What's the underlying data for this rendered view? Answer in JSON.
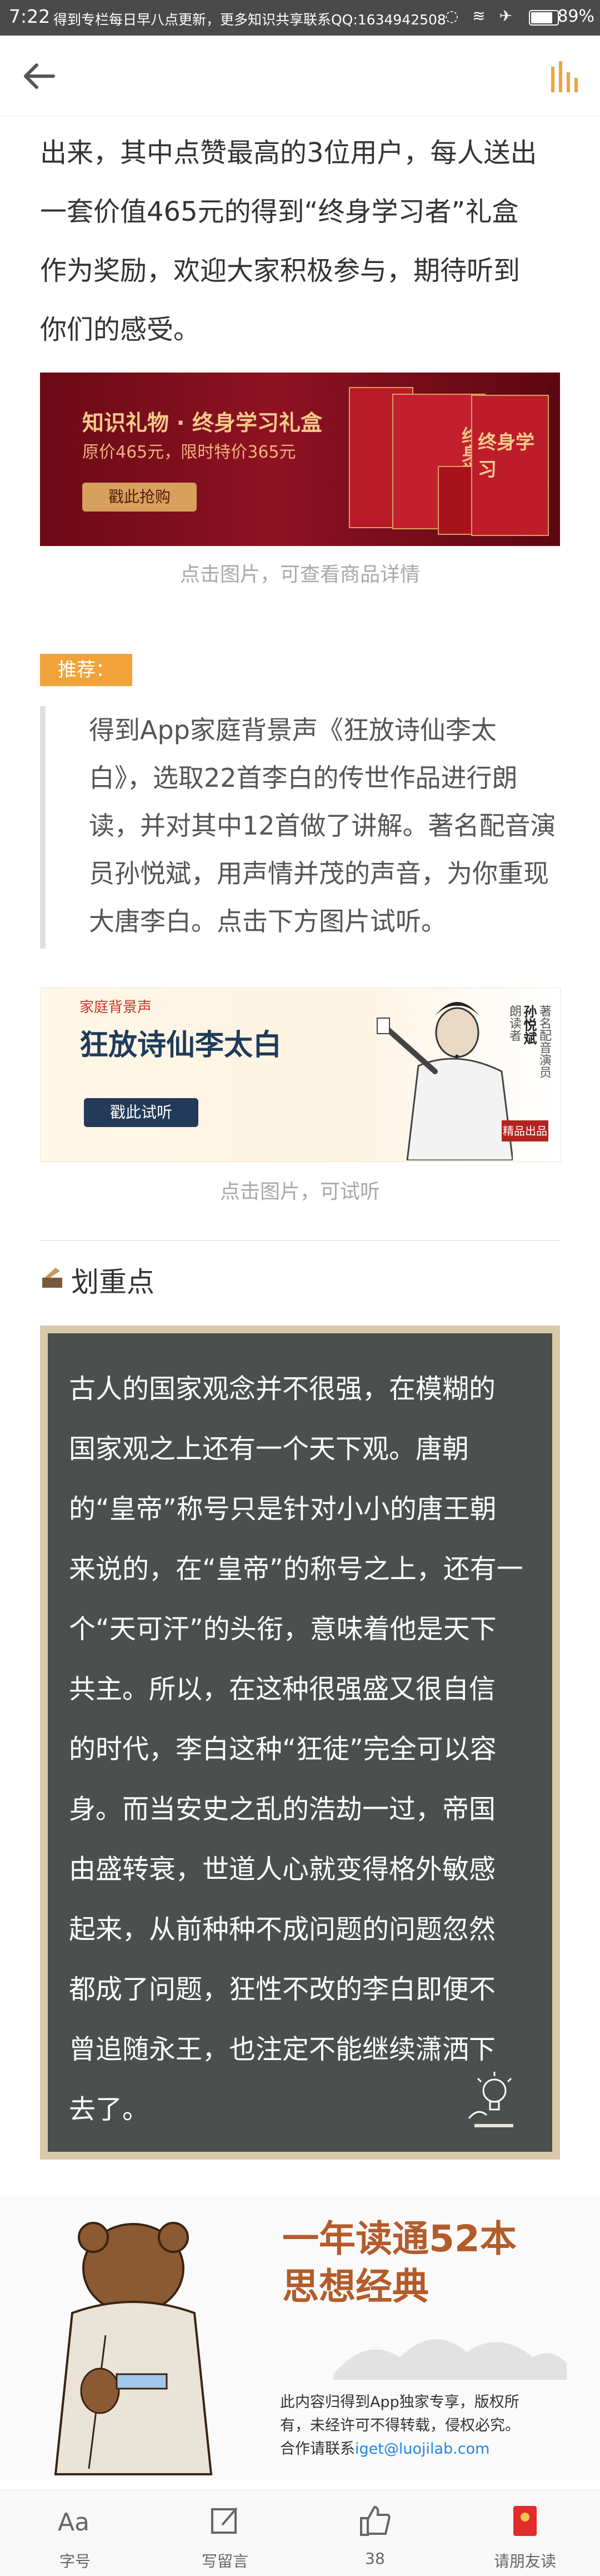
{
  "status_bar": {
    "time": "7:22",
    "notice": "得到专栏每日早八点更新，更多知识共享联系QQ:1634942508",
    "battery": "89%"
  },
  "nav": {
    "back_icon": "arrow-left-icon",
    "menu_icon": "audio-bars-icon"
  },
  "article": {
    "intro_lines": [
      "出来，其中点赞最高的3位用户，每人送出",
      "一套价值465元的得到“终身学习者”礼盒",
      "作为奖励，欢迎大家积极参与，期待听到",
      "你们的感受。"
    ],
    "gift_banner": {
      "title": "知识礼物 · 终身学习礼盒",
      "price": "原价465元，限时特价365元",
      "button": "戳此抢购",
      "box_text": "终身学习",
      "caption": "点击图片，可查看商品详情"
    },
    "recommend_tag": "推荐：",
    "recommend_lines": [
      "得到App家庭背景声《狂放诗仙李太",
      "白》，选取22首李白的传世作品进行朗",
      "读，并对其中12首做了讲解。著名配音演",
      "员孙悦斌，用声情并茂的声音，为你重现",
      "大唐李白。点击下方图片试听。"
    ],
    "audio_banner": {
      "brand": "家庭背景声",
      "title": "狂放诗仙李太白",
      "button": "戳此试听",
      "reader_name": "孙悦斌",
      "reader_role": "朗读者",
      "reader_desc": "著名配音演员",
      "stamp": "精品出品",
      "caption": "点击图片，可试听"
    },
    "highlight_title": "划重点",
    "highlight_lines": [
      "古人的国家观念并不很强，在模糊的",
      "国家观之上还有一个天下观。唐朝",
      "的“皇帝”称号只是针对小小的唐王朝",
      "来说的，在“皇帝”的称号之上，还有一",
      "个“天可汗”的头衔，意味着他是天下",
      "共主。所以，在这种很强盛又很自信",
      "的时代，李白这种“狂徒”完全可以容",
      "身。而当安史之乱的浩劫一过，帝国",
      "由盛转衰，世道人心就变得格外敏感",
      "起来，从前种种不成问题的问题忽然",
      "都成了问题，狂性不改的李白即便不",
      "曾追随永王，也注定不能继续潇洒下",
      "去了。"
    ],
    "footer_promo": {
      "title_line1": "一年读通52本",
      "title_line2": "思想经典",
      "copyright_line1": "此内容归得到App独家专享，版权所",
      "copyright_line2": "有，未经许可不得转载，侵权必究。",
      "contact_prefix": "合作请联系",
      "contact_email": "iget@luojilab.com"
    }
  },
  "bottom_bar": {
    "tabs": [
      {
        "label": "字号",
        "icon": "font-size-icon"
      },
      {
        "label": "写留言",
        "icon": "edit-icon"
      },
      {
        "label": "38",
        "icon": "thumbs-up-icon"
      },
      {
        "label": "请朋友读",
        "icon": "red-envelope-icon"
      }
    ]
  },
  "colors": {
    "accent": "#f1a33a",
    "board": "#4b504e",
    "banner_red": "#8e1222"
  }
}
